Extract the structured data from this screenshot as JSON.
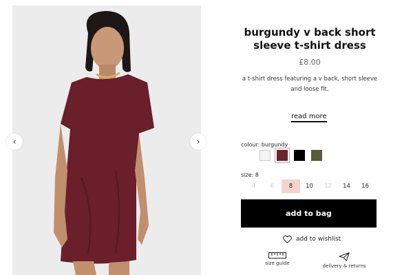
{
  "gallery": {
    "prev_arrow": "‹",
    "next_arrow": "›"
  },
  "product": {
    "title_line1": "burgundy v back short",
    "title_line2": "sleeve t-shirt dress",
    "price": "£8.00",
    "description_line1": "a t-shirt dress featuring a v back, short sleeve",
    "description_line2": "and loose fit.",
    "read_more": "read more"
  },
  "colour": {
    "label": "colour: burgundy",
    "swatches": [
      {
        "color": "#f4f4f4",
        "selected": false
      },
      {
        "color": "#6a2431",
        "selected": true
      },
      {
        "color": "#000000",
        "selected": false
      },
      {
        "color": "#5b5a3c",
        "selected": false
      }
    ]
  },
  "size": {
    "label": "size: 8",
    "options": [
      {
        "label": "4",
        "available": false,
        "selected": false
      },
      {
        "label": "6",
        "available": false,
        "selected": false
      },
      {
        "label": "8",
        "available": true,
        "selected": true
      },
      {
        "label": "10",
        "available": true,
        "selected": false
      },
      {
        "label": "12",
        "available": false,
        "selected": false
      },
      {
        "label": "14",
        "available": true,
        "selected": false
      },
      {
        "label": "16",
        "available": true,
        "selected": false
      }
    ]
  },
  "actions": {
    "add_to_bag": "add to bag",
    "wishlist": "add to wishlist",
    "size_guide": "size guide",
    "delivery": "delivery & returns"
  },
  "colors": {
    "dress": "#6a1f2b",
    "selected_size_bg": "#f6d3d0",
    "button_bg": "#000000"
  }
}
